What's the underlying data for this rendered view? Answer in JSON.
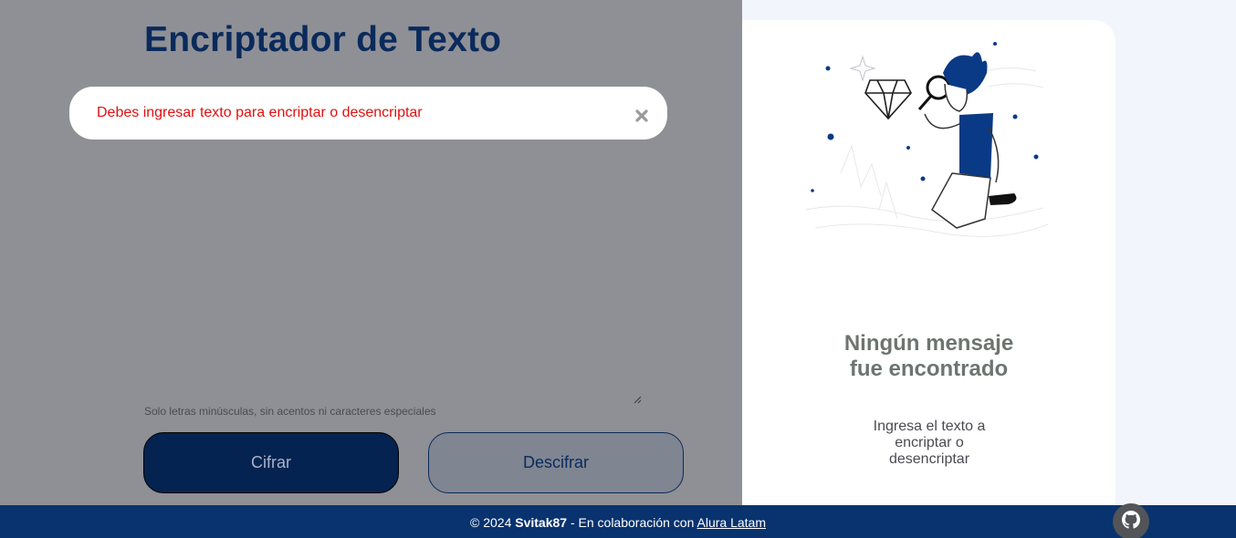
{
  "main": {
    "title": "Encriptador de Texto",
    "alert_message": "Debes ingresar texto para encriptar o desencriptar",
    "hint": "Solo letras minúsculas, sin acentos ni caracteres especiales",
    "encrypt_label": "Cifrar",
    "decrypt_label": "Descifrar"
  },
  "output": {
    "empty_title_line1": "Ningún mensaje",
    "empty_title_line2": "fue encontrado",
    "empty_desc_line1": "Ingresa el texto a",
    "empty_desc_line2": "encriptar o",
    "empty_desc_line3": "desencriptar",
    "illustration_icon": "person-magnifying-glass-illustration"
  },
  "footer": {
    "copyright": "© 2024",
    "author": "Svitak87",
    "collab_text": "- En colaboración con",
    "collab_link": "Alura Latam",
    "github_icon": "github-icon"
  },
  "colors": {
    "title": "#0A2A5C",
    "alert_text": "#E01010",
    "encrypt_button": "#052350",
    "footer_bg": "#08336E",
    "overlay": "#8F9095"
  }
}
